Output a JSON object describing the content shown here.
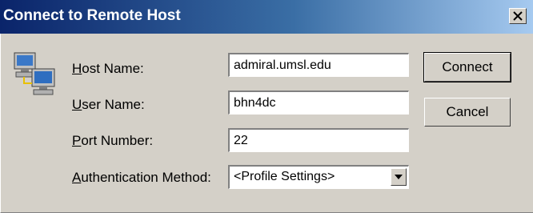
{
  "window": {
    "title": "Connect to Remote Host",
    "close_glyph": "✕"
  },
  "form": {
    "host_name": {
      "label_accel": "H",
      "label_rest": "ost Name:",
      "value": "admiral.umsl.edu"
    },
    "user_name": {
      "label_accel": "U",
      "label_rest": "ser Name:",
      "value": "bhn4dc"
    },
    "port_number": {
      "label_accel": "P",
      "label_rest": "ort Number:",
      "value": "22"
    },
    "auth_method": {
      "label_accel": "A",
      "label_rest": "uthentication Method:",
      "selected": "<Profile Settings>"
    }
  },
  "buttons": {
    "connect": "Connect",
    "cancel": "Cancel"
  },
  "icons": {
    "app": "network-computers-icon",
    "combo_arrow": "dropdown-arrow-icon",
    "close": "close-icon"
  },
  "colors": {
    "title_gradient_start": "#0a246a",
    "title_gradient_end": "#a6caf0",
    "dialog_face": "#d4d0c8"
  }
}
